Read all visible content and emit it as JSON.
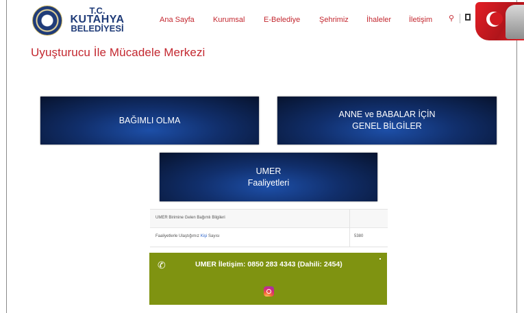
{
  "header": {
    "logo": {
      "line1": "T.C.",
      "line2": "KUTAHYA",
      "line3": "BELEDİYESİ"
    },
    "nav": [
      "Ana Sayfa",
      "Kurumsal",
      "E-Belediye",
      "Şehrimiz",
      "İhaleler",
      "İletişim"
    ],
    "icons": {
      "search": "search-icon",
      "extra": "square-icon"
    }
  },
  "page": {
    "title": "Uyuşturucu İle Mücadele Merkezi"
  },
  "tiles": [
    {
      "lines": [
        "BAĞIMLI OLMA"
      ]
    },
    {
      "lines": [
        "ANNE ve BABALAR İÇİN",
        "GENEL BİLGİLER"
      ]
    },
    {
      "lines": [
        "UMER",
        "Faaliyetleri"
      ]
    }
  ],
  "info_table": {
    "row1": {
      "label": "UMER Birimine Gelen Bağımlı Bilgileri",
      "value": ""
    },
    "row2": {
      "label_pre": "Faaliyetlerle Ulaştığımız ",
      "label_link": "Kişi",
      "label_post": " Sayısı",
      "value": "5380"
    }
  },
  "contact": {
    "text": "UMER İletişim: 0850 283 4343 (Dahili: 2454)",
    "color": "#7f9311"
  },
  "colors": {
    "accent": "#c3272f",
    "logo": "#1f3b78"
  }
}
